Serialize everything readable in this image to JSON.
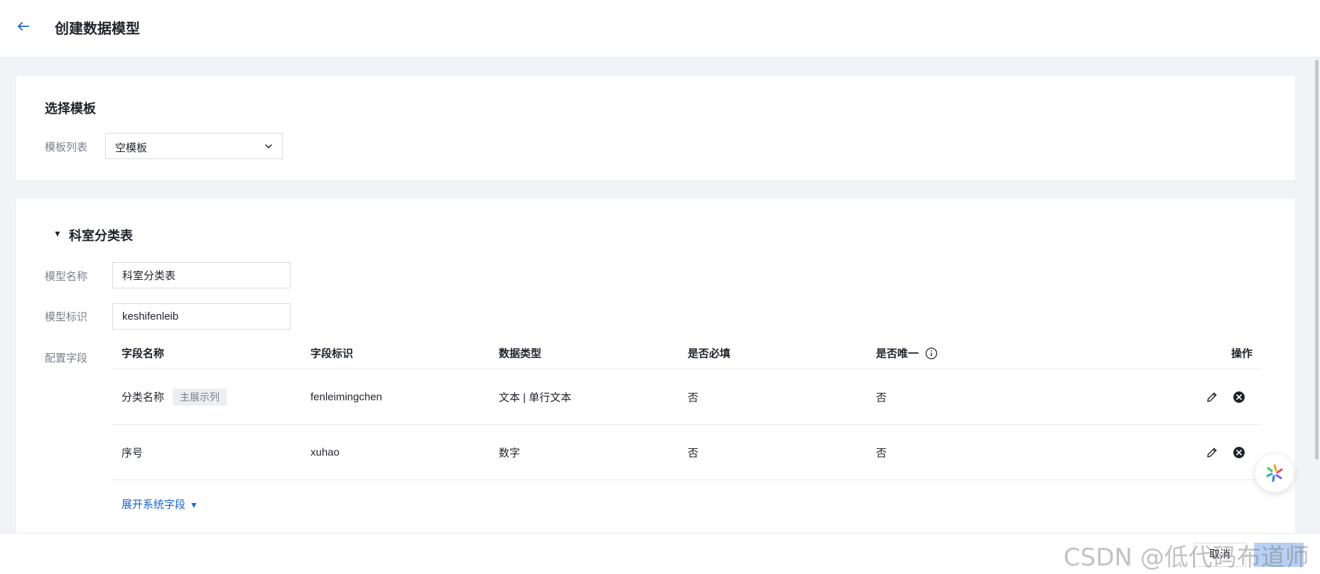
{
  "header": {
    "title": "创建数据模型"
  },
  "template_section": {
    "title": "选择模板",
    "list_label": "模板列表",
    "selected": "空模板"
  },
  "model_section": {
    "title": "科室分类表",
    "name_label": "模型名称",
    "name_value": "科室分类表",
    "id_label": "模型标识",
    "id_value": "keshifenleib",
    "fields_label": "配置字段",
    "columns": [
      "字段名称",
      "字段标识",
      "数据类型",
      "是否必填",
      "是否唯一",
      "操作"
    ],
    "rows": [
      {
        "name": "分类名称",
        "tag": "主展示列",
        "identifier": "fenleimingchen",
        "type": "文本 | 单行文本",
        "required": "否",
        "unique": "否"
      },
      {
        "name": "序号",
        "tag": "",
        "identifier": "xuhao",
        "type": "数字",
        "required": "否",
        "unique": "否"
      }
    ],
    "expand_link": "展开系统字段"
  },
  "footer": {
    "cancel": "取消",
    "confirm": ""
  },
  "watermark": "CSDN @低代码布道师",
  "colors": {
    "accent": "#1764d0",
    "confirm_disabled": "#b7d0f3"
  }
}
